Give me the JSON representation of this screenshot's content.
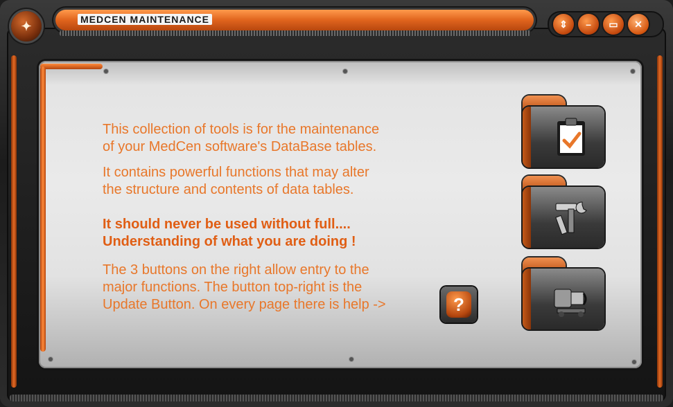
{
  "window": {
    "title": "MEDCEN MAINTENANCE",
    "buttons": [
      {
        "name": "help-window-button",
        "glyph": "⇕"
      },
      {
        "name": "minimize-button",
        "glyph": "–"
      },
      {
        "name": "maximize-button",
        "glyph": "▭"
      },
      {
        "name": "close-button",
        "glyph": "✕"
      }
    ]
  },
  "content": {
    "para1_line1": "This collection of tools is for the maintenance",
    "para1_line2": "of your MedCen software's DataBase tables.",
    "para2_line1": "It contains powerful functions that may alter",
    "para2_line2": "the structure and contents of data tables.",
    "warning_line1": "It should never be used without full....",
    "warning_line2": "Understanding of what you are doing !",
    "para3_line1": "The 3 buttons on the right allow entry to the",
    "para3_line2": "major functions. The button top-right is the",
    "para3_line3": "Update Button. On every page there is help ->",
    "help_glyph": "?"
  },
  "function_buttons": [
    {
      "name": "update-button",
      "icon": "clipboard-check-icon"
    },
    {
      "name": "tools-button",
      "icon": "hammer-wrench-icon"
    },
    {
      "name": "machine-button",
      "icon": "machinery-icon"
    }
  ],
  "colors": {
    "accent": "#e8772a",
    "accent_dark": "#b4460e",
    "panel": "#e6e6e6",
    "frame": "#1e1e1e"
  }
}
